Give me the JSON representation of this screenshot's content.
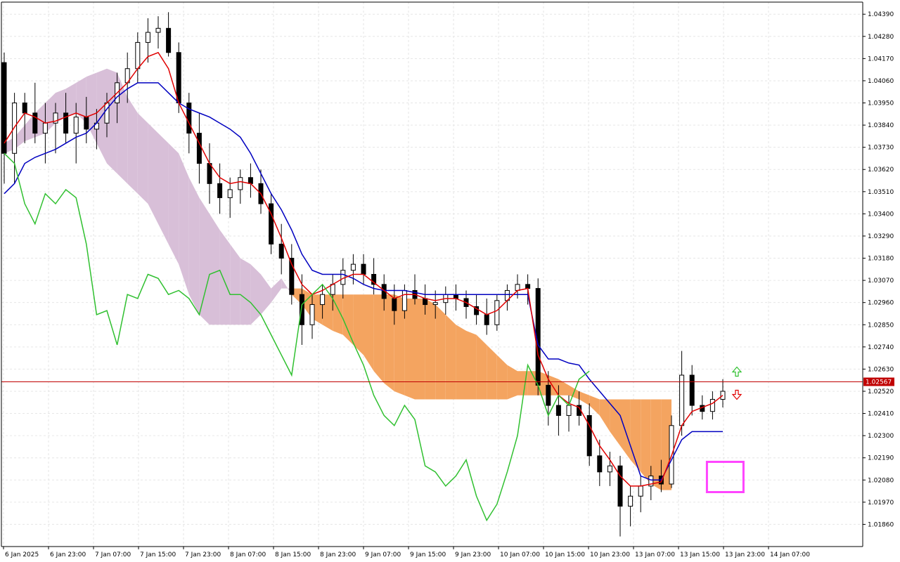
{
  "chart_data": {
    "type": "candlestick",
    "ylim": [
      1.0175,
      1.0445
    ],
    "y_ticks": [
      "1.04390",
      "1.04280",
      "1.04170",
      "1.04060",
      "1.03950",
      "1.03840",
      "1.03730",
      "1.03620",
      "1.03510",
      "1.03400",
      "1.03290",
      "1.03180",
      "1.03070",
      "1.02960",
      "1.02850",
      "1.02740",
      "1.02630",
      "1.02520",
      "1.02410",
      "1.02300",
      "1.02190",
      "1.02080",
      "1.01970",
      "1.01860"
    ],
    "x_ticks": [
      "6 Jan 2025",
      "6 Jan 23:00",
      "7 Jan 07:00",
      "7 Jan 15:00",
      "7 Jan 23:00",
      "8 Jan 07:00",
      "8 Jan 15:00",
      "8 Jan 23:00",
      "9 Jan 07:00",
      "9 Jan 15:00",
      "9 Jan 23:00",
      "10 Jan 07:00",
      "10 Jan 15:00",
      "10 Jan 23:00",
      "13 Jan 07:00",
      "13 Jan 15:00",
      "13 Jan 23:00",
      "14 Jan 07:00"
    ],
    "current_price": "1.02567",
    "colors": {
      "tenkan": "#e00000",
      "kijun": "#0000c0",
      "chikou": "#30c030",
      "kumo_bull": "#f4a460",
      "kumo_bear": "#d8bfd8",
      "price_line": "#c00000",
      "highlight": "#ff44ff",
      "grid": "#e6e6e6"
    },
    "candles": [
      [
        1.0415,
        1.042,
        1.0355,
        1.037
      ],
      [
        1.037,
        1.04,
        1.0355,
        1.0395
      ],
      [
        1.0395,
        1.04,
        1.0375,
        1.039
      ],
      [
        1.039,
        1.0405,
        1.0375,
        1.038
      ],
      [
        1.038,
        1.0395,
        1.0365,
        1.0385
      ],
      [
        1.0385,
        1.0395,
        1.037,
        1.039
      ],
      [
        1.039,
        1.04,
        1.0375,
        1.038
      ],
      [
        1.038,
        1.0395,
        1.0365,
        1.0388
      ],
      [
        1.0388,
        1.0398,
        1.0375,
        1.0382
      ],
      [
        1.0382,
        1.0392,
        1.0372,
        1.0385
      ],
      [
        1.0385,
        1.04,
        1.0378,
        1.0395
      ],
      [
        1.0395,
        1.041,
        1.0385,
        1.0405
      ],
      [
        1.0405,
        1.042,
        1.0395,
        1.0412
      ],
      [
        1.0412,
        1.043,
        1.0405,
        1.0425
      ],
      [
        1.0425,
        1.0437,
        1.0415,
        1.043
      ],
      [
        1.043,
        1.0438,
        1.0422,
        1.0432
      ],
      [
        1.0432,
        1.044,
        1.0418,
        1.042
      ],
      [
        1.042,
        1.0425,
        1.039,
        1.0395
      ],
      [
        1.0395,
        1.04,
        1.037,
        1.038
      ],
      [
        1.038,
        1.039,
        1.0355,
        1.0365
      ],
      [
        1.0365,
        1.0375,
        1.0345,
        1.0355
      ],
      [
        1.0355,
        1.0365,
        1.034,
        1.0348
      ],
      [
        1.0348,
        1.0358,
        1.0338,
        1.0352
      ],
      [
        1.0352,
        1.0362,
        1.0345,
        1.0358
      ],
      [
        1.0358,
        1.0365,
        1.0348,
        1.0355
      ],
      [
        1.0355,
        1.0362,
        1.034,
        1.0345
      ],
      [
        1.0345,
        1.035,
        1.032,
        1.0325
      ],
      [
        1.0325,
        1.0335,
        1.031,
        1.0318
      ],
      [
        1.0318,
        1.0325,
        1.0295,
        1.03
      ],
      [
        1.03,
        1.031,
        1.0275,
        1.0285
      ],
      [
        1.0285,
        1.03,
        1.0278,
        1.0295
      ],
      [
        1.0295,
        1.0305,
        1.0288,
        1.03
      ],
      [
        1.03,
        1.031,
        1.0292,
        1.0305
      ],
      [
        1.0305,
        1.0318,
        1.0298,
        1.0312
      ],
      [
        1.0312,
        1.032,
        1.0305,
        1.0315
      ],
      [
        1.0315,
        1.032,
        1.0305,
        1.031
      ],
      [
        1.031,
        1.0318,
        1.03,
        1.0305
      ],
      [
        1.0305,
        1.031,
        1.0292,
        1.0298
      ],
      [
        1.0298,
        1.0305,
        1.0285,
        1.0292
      ],
      [
        1.0292,
        1.0305,
        1.0288,
        1.0302
      ],
      [
        1.0302,
        1.031,
        1.0295,
        1.0298
      ],
      [
        1.0298,
        1.0305,
        1.029,
        1.0295
      ],
      [
        1.0295,
        1.0302,
        1.0288,
        1.0296
      ],
      [
        1.0296,
        1.0304,
        1.029,
        1.03
      ],
      [
        1.03,
        1.0305,
        1.0292,
        1.0298
      ],
      [
        1.0298,
        1.0302,
        1.0288,
        1.0294
      ],
      [
        1.0294,
        1.03,
        1.0285,
        1.029
      ],
      [
        1.029,
        1.0298,
        1.028,
        1.0285
      ],
      [
        1.0285,
        1.03,
        1.0282,
        1.0297
      ],
      [
        1.0297,
        1.0305,
        1.0292,
        1.0302
      ],
      [
        1.0302,
        1.031,
        1.0298,
        1.0305
      ],
      [
        1.0305,
        1.031,
        1.0295,
        1.0303
      ],
      [
        1.0303,
        1.0308,
        1.025,
        1.0255
      ],
      [
        1.0255,
        1.0262,
        1.0235,
        1.0245
      ],
      [
        1.0245,
        1.0255,
        1.023,
        1.024
      ],
      [
        1.024,
        1.025,
        1.0232,
        1.0245
      ],
      [
        1.0245,
        1.0252,
        1.0235,
        1.024
      ],
      [
        1.024,
        1.0246,
        1.0215,
        1.022
      ],
      [
        1.022,
        1.0228,
        1.0205,
        1.0212
      ],
      [
        1.0212,
        1.0222,
        1.0205,
        1.0215
      ],
      [
        1.0215,
        1.022,
        1.018,
        1.0195
      ],
      [
        1.0195,
        1.0205,
        1.0185,
        1.02
      ],
      [
        1.02,
        1.021,
        1.0192,
        1.0205
      ],
      [
        1.0205,
        1.0215,
        1.0198,
        1.021
      ],
      [
        1.021,
        1.0218,
        1.0202,
        1.0206
      ],
      [
        1.0206,
        1.024,
        1.0204,
        1.0235
      ],
      [
        1.0235,
        1.0272,
        1.023,
        1.026
      ],
      [
        1.026,
        1.0265,
        1.024,
        1.0245
      ],
      [
        1.0245,
        1.025,
        1.0238,
        1.0242
      ],
      [
        1.0242,
        1.0252,
        1.0238,
        1.0248
      ],
      [
        1.0248,
        1.0258,
        1.0244,
        1.0252
      ]
    ],
    "tenkan": [
      1.0375,
      1.0383,
      1.039,
      1.0388,
      1.0385,
      1.0386,
      1.0388,
      1.039,
      1.0388,
      1.039,
      1.0395,
      1.04,
      1.0405,
      1.0412,
      1.0418,
      1.042,
      1.0412,
      1.0395,
      1.0385,
      1.0375,
      1.0365,
      1.0358,
      1.0355,
      1.0356,
      1.0355,
      1.035,
      1.034,
      1.0328,
      1.0315,
      1.0305,
      1.03,
      1.0302,
      1.0305,
      1.0308,
      1.031,
      1.031,
      1.0306,
      1.0302,
      1.0298,
      1.03,
      1.03,
      1.0298,
      1.0297,
      1.0298,
      1.0298,
      1.0296,
      1.0293,
      1.029,
      1.0292,
      1.0297,
      1.0302,
      1.0303,
      1.027,
      1.0258,
      1.025,
      1.0246,
      1.0244,
      1.0235,
      1.0225,
      1.0218,
      1.021,
      1.0205,
      1.0205,
      1.0206,
      1.0207,
      1.022,
      1.0235,
      1.0242,
      1.0244,
      1.0246,
      1.025
    ],
    "kijun": [
      1.035,
      1.0355,
      1.0365,
      1.0368,
      1.037,
      1.0372,
      1.0375,
      1.0378,
      1.038,
      1.0385,
      1.0392,
      1.0398,
      1.0402,
      1.0405,
      1.0405,
      1.0405,
      1.04,
      1.0395,
      1.0392,
      1.039,
      1.0388,
      1.0385,
      1.0382,
      1.0378,
      1.037,
      1.036,
      1.035,
      1.0342,
      1.0332,
      1.032,
      1.0312,
      1.031,
      1.031,
      1.031,
      1.0308,
      1.0305,
      1.0303,
      1.0302,
      1.0302,
      1.0302,
      1.0301,
      1.03,
      1.03,
      1.03,
      1.03,
      1.03,
      1.03,
      1.03,
      1.03,
      1.03,
      1.03,
      1.03,
      1.0275,
      1.0268,
      1.0268,
      1.0266,
      1.0265,
      1.0258,
      1.0252,
      1.0246,
      1.024,
      1.0225,
      1.021,
      1.0208,
      1.0208,
      1.0218,
      1.0228,
      1.0232,
      1.0232,
      1.0232,
      1.0232
    ],
    "chikou": [
      1.037,
      1.0365,
      1.0345,
      1.0335,
      1.035,
      1.0345,
      1.0352,
      1.0348,
      1.0325,
      1.029,
      1.0292,
      1.0275,
      1.03,
      1.0298,
      1.031,
      1.0308,
      1.03,
      1.0302,
      1.0298,
      1.029,
      1.031,
      1.0312,
      1.03,
      1.03,
      1.0296,
      1.029,
      1.028,
      1.027,
      1.026,
      1.0295,
      1.03,
      1.0305,
      1.0298,
      1.0288,
      1.0276,
      1.0265,
      1.025,
      1.024,
      1.0235,
      1.0245,
      1.0238,
      1.0215,
      1.0212,
      1.0205,
      1.021,
      1.0218,
      1.02,
      1.0188,
      1.0196,
      1.0212,
      1.023,
      1.0265,
      1.0255,
      1.024,
      1.025,
      1.0245,
      1.0258,
      1.0262
    ],
    "kumo": [
      [
        1.037,
        1.0375
      ],
      [
        1.0372,
        1.0378
      ],
      [
        1.0376,
        1.0384
      ],
      [
        1.0378,
        1.039
      ],
      [
        1.038,
        1.0395
      ],
      [
        1.0385,
        1.04
      ],
      [
        1.0388,
        1.0402
      ],
      [
        1.039,
        1.0405
      ],
      [
        1.0385,
        1.0408
      ],
      [
        1.0375,
        1.041
      ],
      [
        1.0365,
        1.0412
      ],
      [
        1.036,
        1.041
      ],
      [
        1.0355,
        1.0398
      ],
      [
        1.035,
        1.039
      ],
      [
        1.0345,
        1.0385
      ],
      [
        1.0335,
        1.038
      ],
      [
        1.0325,
        1.0375
      ],
      [
        1.0315,
        1.037
      ],
      [
        1.03,
        1.0358
      ],
      [
        1.029,
        1.0348
      ],
      [
        1.0285,
        1.034
      ],
      [
        1.0285,
        1.0332
      ],
      [
        1.0285,
        1.0325
      ],
      [
        1.0285,
        1.0318
      ],
      [
        1.0285,
        1.0315
      ],
      [
        1.029,
        1.031
      ],
      [
        1.0296,
        1.0303
      ],
      [
        1.0303,
        1.0308
      ],
      [
        1.0303,
        1.03
      ],
      [
        1.0303,
        1.0295
      ],
      [
        1.03,
        1.0288
      ],
      [
        1.03,
        1.0285
      ],
      [
        1.03,
        1.0282
      ],
      [
        1.03,
        1.028
      ],
      [
        1.03,
        1.0275
      ],
      [
        1.03,
        1.027
      ],
      [
        1.03,
        1.0262
      ],
      [
        1.03,
        1.0256
      ],
      [
        1.03,
        1.0252
      ],
      [
        1.0298,
        1.025
      ],
      [
        1.0298,
        1.0248
      ],
      [
        1.0298,
        1.0248
      ],
      [
        1.0295,
        1.0248
      ],
      [
        1.029,
        1.0248
      ],
      [
        1.0285,
        1.0248
      ],
      [
        1.0282,
        1.0248
      ],
      [
        1.028,
        1.0248
      ],
      [
        1.0275,
        1.0248
      ],
      [
        1.027,
        1.0248
      ],
      [
        1.0265,
        1.0248
      ],
      [
        1.0262,
        1.025
      ],
      [
        1.0262,
        1.025
      ],
      [
        1.0262,
        1.025
      ],
      [
        1.026,
        1.025
      ],
      [
        1.0258,
        1.025
      ],
      [
        1.0255,
        1.025
      ],
      [
        1.0252,
        1.0248
      ],
      [
        1.025,
        1.0245
      ],
      [
        1.0248,
        1.024
      ],
      [
        1.0248,
        1.0232
      ],
      [
        1.0248,
        1.0225
      ],
      [
        1.0248,
        1.0218
      ],
      [
        1.0248,
        1.0212
      ],
      [
        1.0248,
        1.0206
      ],
      [
        1.0248,
        1.0203
      ],
      [
        1.0248,
        1.0203
      ]
    ]
  }
}
